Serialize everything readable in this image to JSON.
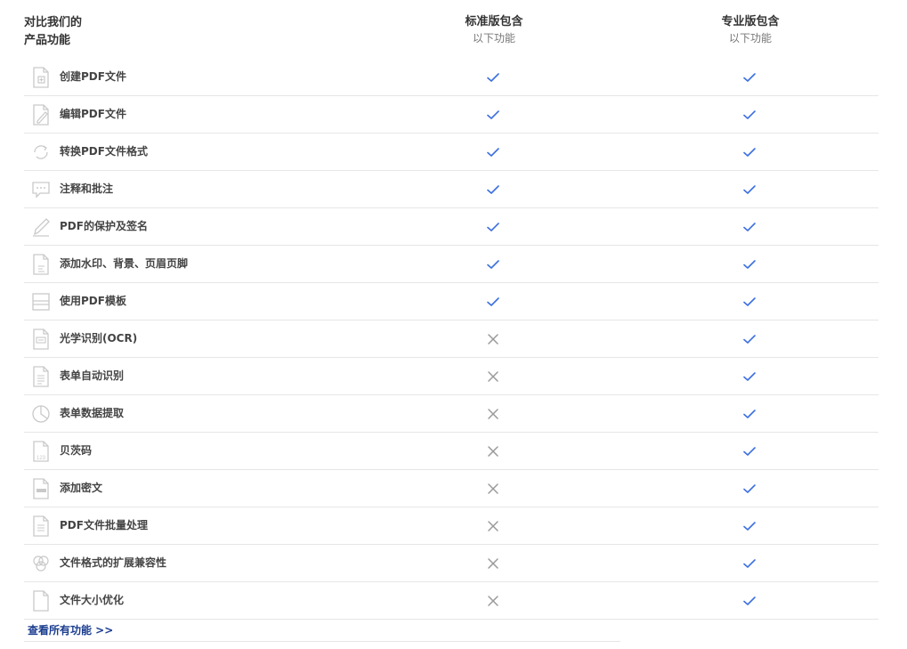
{
  "header": {
    "title_line1": "对比我们的",
    "title_line2": "产品功能",
    "columns": [
      {
        "name": "标准版包含",
        "sub": "以下功能"
      },
      {
        "name": "专业版包含",
        "sub": "以下功能"
      }
    ]
  },
  "colors": {
    "check": "#3b6fe0",
    "cross": "#9a9a9a",
    "icon": "#c9c9c9",
    "link": "#1a3d8f"
  },
  "features": [
    {
      "label": "创建PDF文件",
      "icon": "file-plus-icon",
      "standard": true,
      "pro": true
    },
    {
      "label": "编辑PDF文件",
      "icon": "file-edit-icon",
      "standard": true,
      "pro": true
    },
    {
      "label": "转换PDF文件格式",
      "icon": "convert-icon",
      "standard": true,
      "pro": true
    },
    {
      "label": "注释和批注",
      "icon": "comment-icon",
      "standard": true,
      "pro": true
    },
    {
      "label": "PDF的保护及签名",
      "icon": "pen-sign-icon",
      "standard": true,
      "pro": true
    },
    {
      "label": "添加水印、背景、页眉页脚",
      "icon": "file-watermark-icon",
      "standard": true,
      "pro": true
    },
    {
      "label": "使用PDF模板",
      "icon": "template-icon",
      "standard": true,
      "pro": true
    },
    {
      "label": "光学识别(OCR)",
      "icon": "ocr-icon",
      "standard": false,
      "pro": true
    },
    {
      "label": "表单自动识别",
      "icon": "form-icon",
      "standard": false,
      "pro": true
    },
    {
      "label": "表单数据提取",
      "icon": "pie-chart-icon",
      "standard": false,
      "pro": true
    },
    {
      "label": "贝茨码",
      "icon": "bates-number-icon",
      "standard": false,
      "pro": true
    },
    {
      "label": "添加密文",
      "icon": "redact-icon",
      "standard": false,
      "pro": true
    },
    {
      "label": "PDF文件批量处理",
      "icon": "batch-file-icon",
      "standard": false,
      "pro": true
    },
    {
      "label": "文件格式的扩展兼容性",
      "icon": "formats-icon",
      "standard": false,
      "pro": true
    },
    {
      "label": "文件大小优化",
      "icon": "file-optimize-icon",
      "standard": false,
      "pro": true
    }
  ],
  "footer": {
    "link_label": "查看所有功能 >>"
  }
}
